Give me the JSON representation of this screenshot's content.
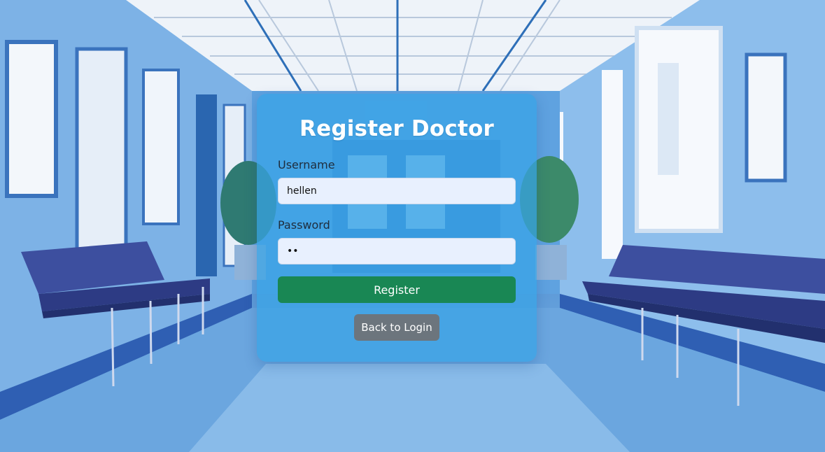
{
  "form": {
    "title": "Register Doctor",
    "username_label": "Username",
    "username_value": "hellen",
    "password_label": "Password",
    "password_value": "••",
    "register_label": "Register",
    "back_label": "Back to Login"
  },
  "colors": {
    "card_bg": "#38a4e6",
    "register_button": "#198754",
    "back_button": "#6c757d",
    "input_bg": "#e8f0fe"
  }
}
